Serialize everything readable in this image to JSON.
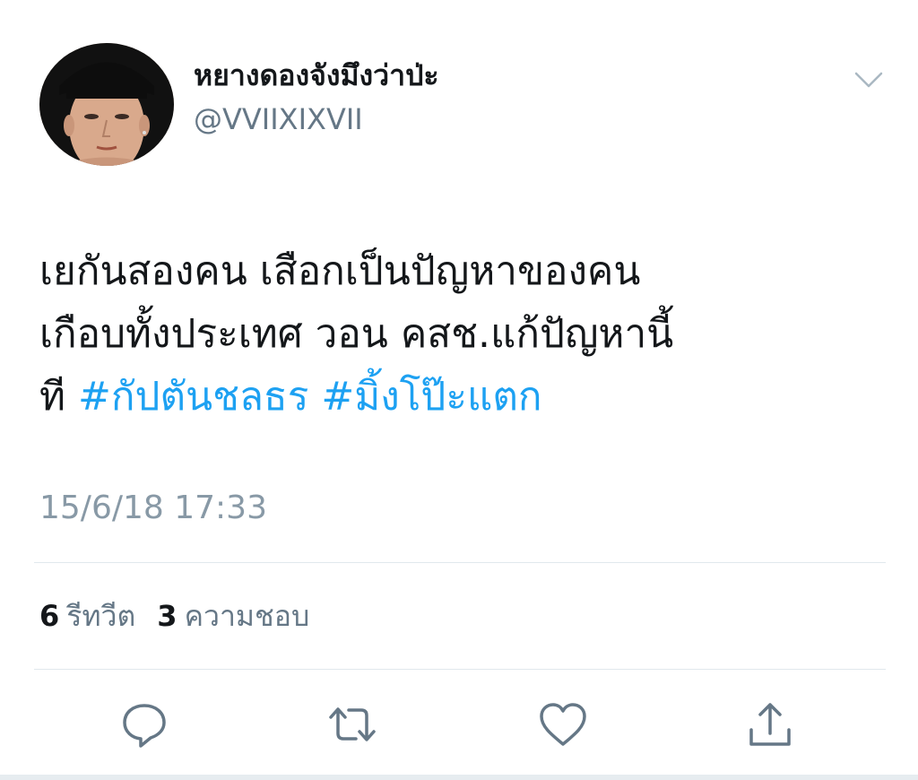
{
  "user": {
    "display_name": "หยางดองจังมึงว่าป่ะ",
    "handle": "@VVIIXIXVII",
    "avatar_icon": "profile-photo"
  },
  "tweet": {
    "line1": "เยกันสองคน เสือกเป็นปัญหาของคน",
    "line2": "เกือบทั้งประเทศ วอน คสช.แก้ปัญหานี้",
    "line3_prefix": "ที ",
    "hashtags": [
      "#กัปตันชลธร",
      "#มิ้งโป๊ะแตก"
    ],
    "timestamp": "15/6/18 17:33"
  },
  "stats": {
    "retweet_count": "6",
    "retweet_label": "รีทวีต",
    "like_count": "3",
    "like_label": "ความชอบ"
  },
  "actions": {
    "reply_icon": "reply-icon",
    "retweet_icon": "retweet-icon",
    "like_icon": "heart-icon",
    "share_icon": "share-icon"
  },
  "colors": {
    "hashtag": "#1da1f2",
    "secondary_text": "#657786",
    "timestamp": "#8899a6",
    "icon": "#657786",
    "divider": "#e1e8ed"
  }
}
